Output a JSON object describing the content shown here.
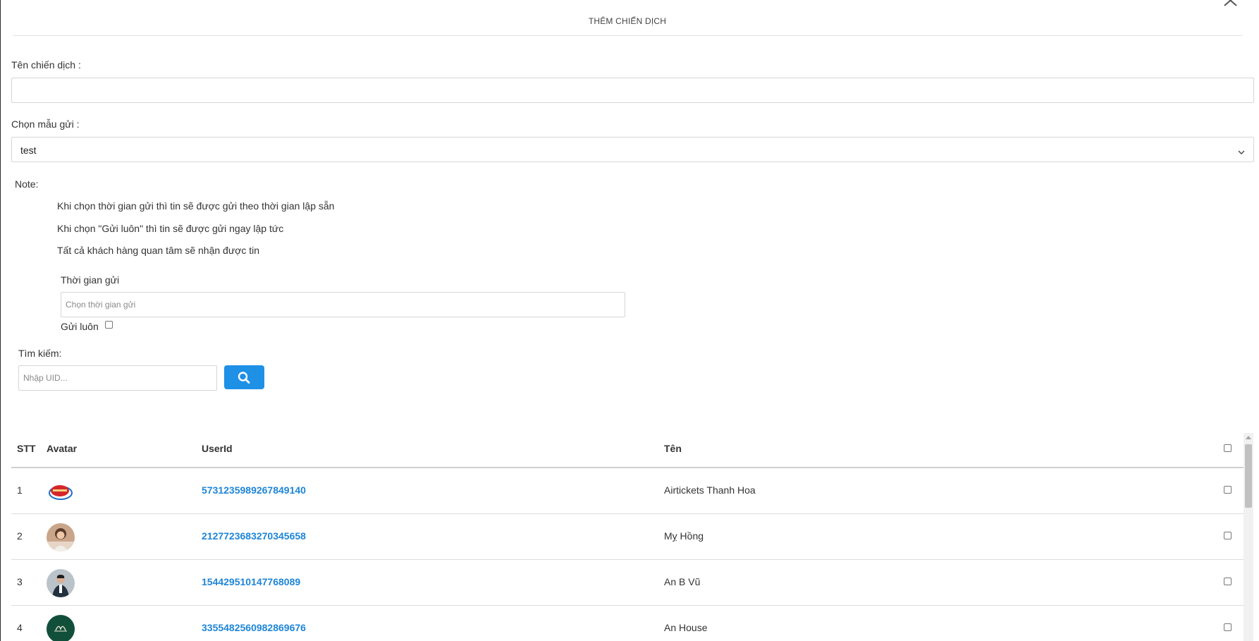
{
  "modal": {
    "title": "THÊM CHIẾN DỊCH"
  },
  "form": {
    "campaign_name_label": "Tên chiến dịch :",
    "campaign_name_value": "",
    "template_label": "Chọn mẫu gửi :",
    "template_selected": "test",
    "note_label": "Note:",
    "notes": [
      "Khi chọn thời gian gửi thì tin sẽ được gửi theo thời gian lập sẵn",
      "Khi chọn \"Gửi luôn\" thì tin sẽ được gửi ngay lập tức",
      "Tất cả khách hàng quan tâm sẽ nhận được tin"
    ],
    "send_time_label": "Thời gian gửi",
    "send_time_placeholder": "Chọn thời gian gửi",
    "send_now_label": "Gửi luôn",
    "send_now_checked": false,
    "search_label": "Tìm kiếm:",
    "search_placeholder": "Nhập UID..."
  },
  "table": {
    "headers": [
      "STT",
      "Avatar",
      "UserId",
      "Tên"
    ],
    "rows": [
      {
        "stt": "1",
        "avatar": "airtickets-logo",
        "user_id": "5731235989267849140",
        "name": "Airtickets Thanh Hoa"
      },
      {
        "stt": "2",
        "avatar": "woman-photo",
        "user_id": "2127723683270345658",
        "name": "Mỵ Hồng"
      },
      {
        "stt": "3",
        "avatar": "man-photo",
        "user_id": "154429510147768089",
        "name": "An B Vũ"
      },
      {
        "stt": "4",
        "avatar": "an-house-logo",
        "user_id": "3355482560982869676",
        "name": "An House"
      }
    ]
  },
  "colors": {
    "accent": "#1e90e6",
    "link": "#1d85d8"
  }
}
